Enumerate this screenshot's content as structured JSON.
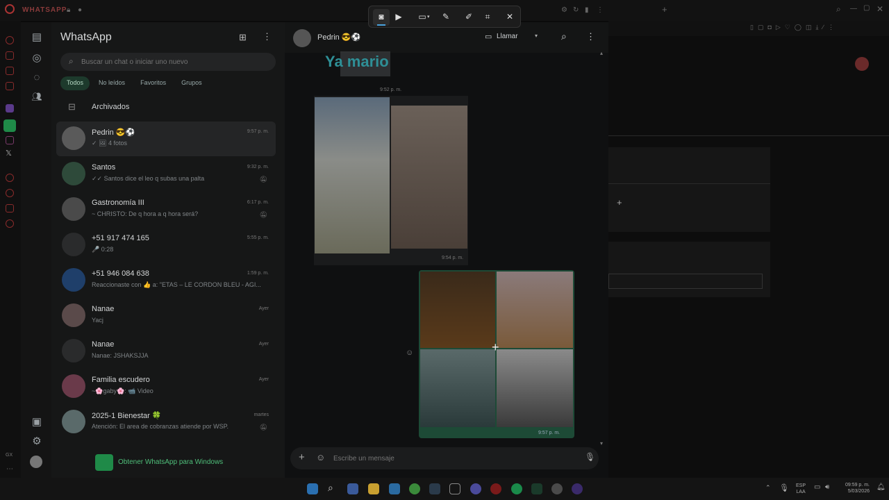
{
  "browser": {
    "app_name": "WHATSAPP",
    "colors": {
      "opera_red": "#a33333",
      "wa_green": "#1f8a48"
    }
  },
  "whatsapp": {
    "title": "WhatsApp",
    "search_placeholder": "Buscar un chat o iniciar uno nuevo",
    "filters": [
      "Todos",
      "No leídos",
      "Favoritos",
      "Grupos"
    ],
    "archived_label": "Archivados",
    "chats": [
      {
        "name": "Pedrin 😎⚽",
        "time": "9:57 p. m.",
        "preview": "✓ 🖼 4 fotos",
        "muted": false
      },
      {
        "name": "Santos",
        "time": "9:32 p. m.",
        "preview": "✓✓ Santos dice el leo q subas una palta",
        "muted": true
      },
      {
        "name": "Gastronomía III",
        "time": "6:17 p. m.",
        "preview": "~ CHRISTO: De q hora a q hora será?",
        "muted": true
      },
      {
        "name": "+51 917 474 165",
        "time": "5:55 p. m.",
        "preview": "🎤 0:28",
        "muted": false
      },
      {
        "name": "+51 946 084 638",
        "time": "1:59 p. m.",
        "preview": "Reaccionaste con 👍 a: \"ETAS – LE CORDON BLEU - AGI...",
        "muted": false
      },
      {
        "name": "Nanae",
        "time": "Ayer",
        "preview": "Yacj",
        "muted": false
      },
      {
        "name": "Nanae",
        "time": "Ayer",
        "preview": "Nanae: JSHAKSJJA",
        "muted": false
      },
      {
        "name": "Familia escudero",
        "time": "Ayer",
        "preview": "~🌸gaby🌸: 📹 Video",
        "muted": false
      },
      {
        "name": "2025-1 Bienestar 🍀",
        "time": "martes",
        "preview": "Atención: El area de cobranzas atiende por WSP.",
        "muted": true
      }
    ],
    "get_app_label": "Obtener WhatsApp para Windows",
    "conversation": {
      "contact_name": "Pedrin 😎⚽",
      "call_label": "Llamar",
      "sticker_text": "Ya mario",
      "messages": [
        {
          "time": "9:52 p. m."
        },
        {
          "time": "9:54 p. m."
        },
        {
          "time": "9:57 p. m."
        }
      ],
      "composer_placeholder": "Escribe un mensaje"
    }
  },
  "taskbar": {
    "lang_top": "ESP",
    "lang_bottom": "LAA",
    "time": "09:59 p. m.",
    "date": "5/03/2026"
  }
}
